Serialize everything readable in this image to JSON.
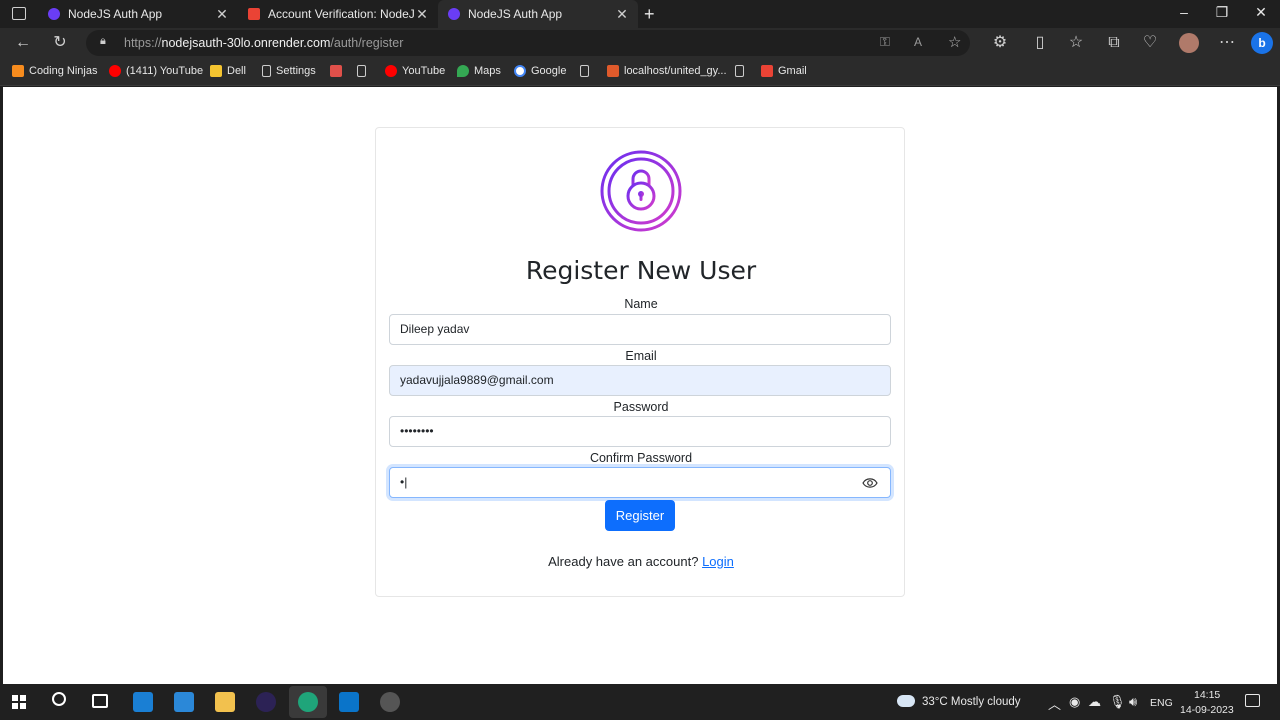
{
  "browser": {
    "tabs": [
      {
        "label": "NodeJS Auth App",
        "favicon_color": "#6a3df5"
      },
      {
        "label": "Account Verification: NodeJS Aut",
        "favicon_color": "#ea4335"
      },
      {
        "label": "NodeJS Auth App",
        "favicon_color": "#6a3df5"
      }
    ],
    "url_prefix": "https://",
    "url_host": "nodejsauth-30lo.onrender.com",
    "url_path": "/auth/register",
    "bookmarks": [
      {
        "label": "Coding Ninjas",
        "color": "#f78c1e"
      },
      {
        "label": "(1411) YouTube",
        "color": "#ff0000"
      },
      {
        "label": "Dell",
        "color": "#f4c430"
      },
      {
        "label": "Settings",
        "color": "#cccccc"
      },
      {
        "label": "",
        "color": "#e0504a"
      },
      {
        "label": "",
        "color": "#cccccc"
      },
      {
        "label": "YouTube",
        "color": "#ff0000"
      },
      {
        "label": "Maps",
        "color": "#34a853"
      },
      {
        "label": "Google",
        "color": "#ffffff"
      },
      {
        "label": "",
        "color": "#cccccc"
      },
      {
        "label": "localhost/united_gy...",
        "color": "#e05a2b"
      },
      {
        "label": "",
        "color": "#cccccc"
      },
      {
        "label": "Gmail",
        "color": "#ea4335"
      }
    ]
  },
  "page": {
    "title": "Register New User",
    "fields": {
      "name": {
        "label": "Name",
        "value": "Dileep yadav"
      },
      "email": {
        "label": "Email",
        "value": "yadavujjala9889@gmail.com"
      },
      "password": {
        "label": "Password",
        "value": "••••••••"
      },
      "confirm": {
        "label": "Confirm Password",
        "value": "•|"
      }
    },
    "register_label": "Register",
    "already_text": "Already have an account?",
    "login_link": "Login",
    "colors": {
      "primary": "#0d6efd",
      "logo_gradient_start": "#7b2ff7",
      "logo_gradient_end": "#c23bd4"
    }
  },
  "taskbar": {
    "weather": "33°C  Mostly cloudy",
    "lang": "ENG",
    "time": "14:15",
    "date": "14-09-2023"
  }
}
